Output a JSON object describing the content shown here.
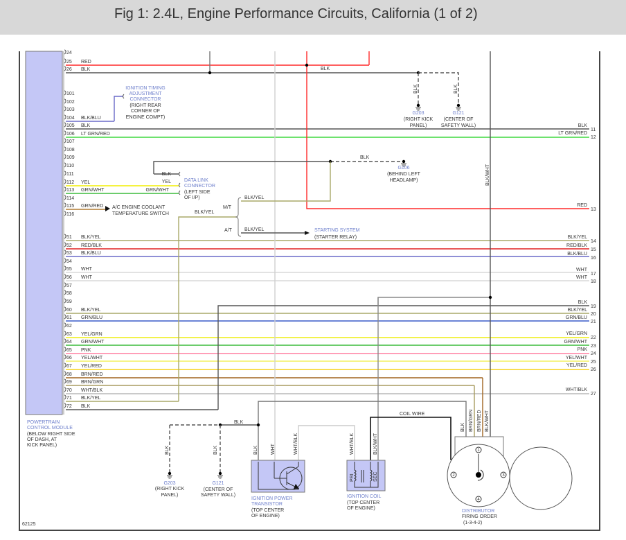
{
  "header": {
    "title": "Fig 1: 2.4L, Engine Performance Circuits, California (1 of 2)"
  },
  "figure_id": "62125",
  "wire_colors": {
    "RED": "#ff2a2a",
    "BLK": "#555555",
    "BLK/BLU": "#6a6ac8",
    "LT GRN/RED": "#3fd83f",
    "YEL": "#f2ee00",
    "GRN/WHT": "#3cbc3c",
    "GRN/RED": "#b07a30",
    "BLK/YEL": "#a8a868",
    "RED/BLK": "#e02020",
    "WHT": "#d8d8d8",
    "GRN/BLU": "#3a5cc8",
    "YEL/GRN": "#eeee10",
    "PNK": "#ff7fa0",
    "YEL/WHT": "#f4f060",
    "YEL/RED": "#f6d21a",
    "BRN/RED": "#a0641e",
    "BRN/GRN": "#a89c60",
    "WHT/BLK": "#b8b8b8",
    "BLK/WHT": "#555555"
  },
  "pcm": {
    "name": "POWERTRAIN CONTROL MODULE",
    "name_lines": [
      "POWERTRAIN",
      "CONTROL MODULE"
    ],
    "location_lines": [
      "(BELOW RIGHT SIDE",
      "OF DASH, AT",
      "KICK PANEL)"
    ],
    "pins": [
      {
        "num": "24",
        "wire": ""
      },
      {
        "num": "25",
        "wire": "RED"
      },
      {
        "num": "26",
        "wire": "BLK"
      },
      {
        "num": "101",
        "wire": ""
      },
      {
        "num": "102",
        "wire": ""
      },
      {
        "num": "103",
        "wire": ""
      },
      {
        "num": "104",
        "wire": "BLK/BLU"
      },
      {
        "num": "105",
        "wire": "BLK"
      },
      {
        "num": "106",
        "wire": "LT GRN/RED"
      },
      {
        "num": "107",
        "wire": ""
      },
      {
        "num": "108",
        "wire": ""
      },
      {
        "num": "109",
        "wire": ""
      },
      {
        "num": "110",
        "wire": ""
      },
      {
        "num": "111",
        "wire": ""
      },
      {
        "num": "112",
        "wire": "YEL"
      },
      {
        "num": "113",
        "wire": "GRN/WHT"
      },
      {
        "num": "114",
        "wire": ""
      },
      {
        "num": "115",
        "wire": "GRN/RED"
      },
      {
        "num": "116",
        "wire": ""
      },
      {
        "num": "51",
        "wire": "BLK/YEL"
      },
      {
        "num": "52",
        "wire": "RED/BLK"
      },
      {
        "num": "53",
        "wire": "BLK/BLU"
      },
      {
        "num": "54",
        "wire": ""
      },
      {
        "num": "55",
        "wire": "WHT"
      },
      {
        "num": "56",
        "wire": "WHT"
      },
      {
        "num": "57",
        "wire": ""
      },
      {
        "num": "58",
        "wire": ""
      },
      {
        "num": "59",
        "wire": ""
      },
      {
        "num": "60",
        "wire": "BLK/YEL"
      },
      {
        "num": "61",
        "wire": "GRN/BLU"
      },
      {
        "num": "62",
        "wire": ""
      },
      {
        "num": "63",
        "wire": "YEL/GRN"
      },
      {
        "num": "64",
        "wire": "GRN/WHT"
      },
      {
        "num": "65",
        "wire": "PNK"
      },
      {
        "num": "66",
        "wire": "YEL/WHT"
      },
      {
        "num": "67",
        "wire": "YEL/RED"
      },
      {
        "num": "68",
        "wire": "BRN/RED"
      },
      {
        "num": "69",
        "wire": "BRN/GRN"
      },
      {
        "num": "70",
        "wire": "WHT/BLK"
      },
      {
        "num": "71",
        "wire": "BLK/YEL"
      },
      {
        "num": "72",
        "wire": "BLK"
      }
    ]
  },
  "right_terminals": [
    {
      "num": "11",
      "wire": "BLK"
    },
    {
      "num": "12",
      "wire": "LT GRN/RED"
    },
    {
      "num": "13",
      "wire": "RED"
    },
    {
      "num": "14",
      "wire": "BLK/YEL"
    },
    {
      "num": "15",
      "wire": "RED/BLK"
    },
    {
      "num": "16",
      "wire": "BLK/BLU"
    },
    {
      "num": "17",
      "wire": "WHT"
    },
    {
      "num": "18",
      "wire": "WHT"
    },
    {
      "num": "19",
      "wire": "BLK"
    },
    {
      "num": "20",
      "wire": "BLK/YEL"
    },
    {
      "num": "21",
      "wire": "GRN/BLU"
    },
    {
      "num": "22",
      "wire": "YEL/GRN"
    },
    {
      "num": "23",
      "wire": "GRN/WHT"
    },
    {
      "num": "24",
      "wire": "PNK"
    },
    {
      "num": "25",
      "wire": "YEL/WHT"
    },
    {
      "num": "26",
      "wire": "YEL/RED"
    },
    {
      "num": "27",
      "wire": "WHT/BLK"
    }
  ],
  "timing_connector": {
    "name_lines": [
      "IGNITION TIMING",
      "ADJUSTMENT",
      "CONNECTOR"
    ],
    "location_lines": [
      "(RIGHT REAR",
      "CORNER OF",
      "ENGINE COMPT)"
    ]
  },
  "data_link_connector": {
    "name_lines": [
      "DATA LINK",
      "CONNECTOR"
    ],
    "location_lines": [
      "(LEFT SIDE",
      "OF I/P)"
    ],
    "pin_labels": [
      "BLK",
      "YEL",
      "GRN/WHT"
    ]
  },
  "ac_switch": {
    "lines": [
      "A/C ENGINE COOLANT",
      "TEMPERATURE SWITCH"
    ]
  },
  "transmission_split": {
    "input_label": "BLK/YEL",
    "mt_label": "M/T",
    "at_label": "A/T",
    "mt_wire": "BLK/YEL",
    "at_wire": "BLK/YEL"
  },
  "starting_system": {
    "name": "STARTING SYSTEM",
    "location": "(STARTER RELAY)"
  },
  "grounds": {
    "top_blk_label": "BLK",
    "g203_top": {
      "id": "G203",
      "wire": "BLK",
      "location_lines": [
        "(RIGHT KICK",
        "PANEL)"
      ]
    },
    "g121_top": {
      "id": "G121",
      "wire": "BLK",
      "location_lines": [
        "(CENTER OF",
        "SAFETY WALL)"
      ]
    },
    "g106": {
      "id": "G106",
      "wire": "BLK",
      "location_lines": [
        "(BEHIND LEFT",
        "HEADLAMP)"
      ]
    },
    "bottom_blk_label": "BLK",
    "g203_bottom": {
      "id": "G203",
      "wire": "BLK",
      "location_lines": [
        "(RIGHT KICK",
        "PANEL)"
      ]
    },
    "g121_bottom": {
      "id": "G121",
      "wire": "BLK",
      "location_lines": [
        "(CENTER OF",
        "SAFETY WALL)"
      ]
    }
  },
  "blk_wht_vertical_label": "BLK/WHT",
  "ignition_power_transistor": {
    "name_lines": [
      "IGNITION POWER",
      "TRANSISTOR"
    ],
    "location_lines": [
      "(TOP CENTER",
      "OF ENGINE)"
    ],
    "pin_labels": [
      "BLK",
      "WHT",
      "WHT/BLK"
    ]
  },
  "ignition_coil": {
    "name": "IGNITION COIL",
    "location_lines": [
      "(TOP CENTER",
      "OF ENGINE)"
    ],
    "pin_labels": [
      "WHT/BLK",
      "BLK/WHT"
    ],
    "winding_labels": [
      "PRI",
      "SEC"
    ]
  },
  "coil_wire_label": "COIL WIRE",
  "distributor": {
    "name": "DISTRIBUTOR",
    "firing_order_label": "FIRING ORDER",
    "firing_order": "(1-3-4-2)",
    "pin_labels": [
      "BLK",
      "BRN/GRN",
      "BRN/RED",
      "BLK/WHT"
    ],
    "cylinders": [
      "1",
      "2",
      "3",
      "4"
    ]
  }
}
